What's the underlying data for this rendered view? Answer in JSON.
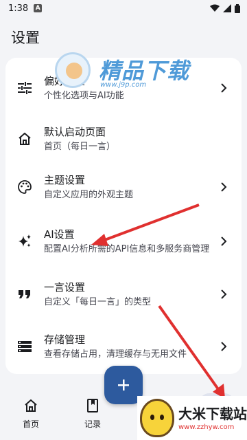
{
  "status_bar": {
    "time": "1:38",
    "badge": "A"
  },
  "header": {
    "title": "设置"
  },
  "settings": [
    {
      "label": "偏好设置",
      "desc": "个性化选项与AI功能",
      "icon": "tune-icon"
    },
    {
      "label": "默认启动页面",
      "desc": "首页（每日一言）",
      "icon": "home-icon"
    },
    {
      "label": "主题设置",
      "desc": "自定义应用的外观主题",
      "icon": "palette-icon"
    },
    {
      "label": "AI设置",
      "desc": "配置AI分析所需的API信息和多服务商管理",
      "icon": "sparkle-icon"
    },
    {
      "label": "一言设置",
      "desc": "自定义「每日一言」的类型",
      "icon": "quote-icon"
    },
    {
      "label": "存储管理",
      "desc": "查看存储占用，清理缓存与无用文件",
      "icon": "storage-icon"
    }
  ],
  "bottom_nav": [
    {
      "label": "首页",
      "icon": "home-icon"
    },
    {
      "label": "记录",
      "icon": "book-icon"
    }
  ],
  "fab": {
    "icon": "plus-icon"
  },
  "watermarks": {
    "top": {
      "title": "精品下载",
      "url": "www.j9p.com"
    },
    "corner": {
      "title": "大米下载站",
      "url": "www.zzhyw.com"
    }
  },
  "colors": {
    "primary": "#2d5a9e",
    "background": "#f3f4f7",
    "card": "#ffffff",
    "arrow": "#e0302f"
  }
}
